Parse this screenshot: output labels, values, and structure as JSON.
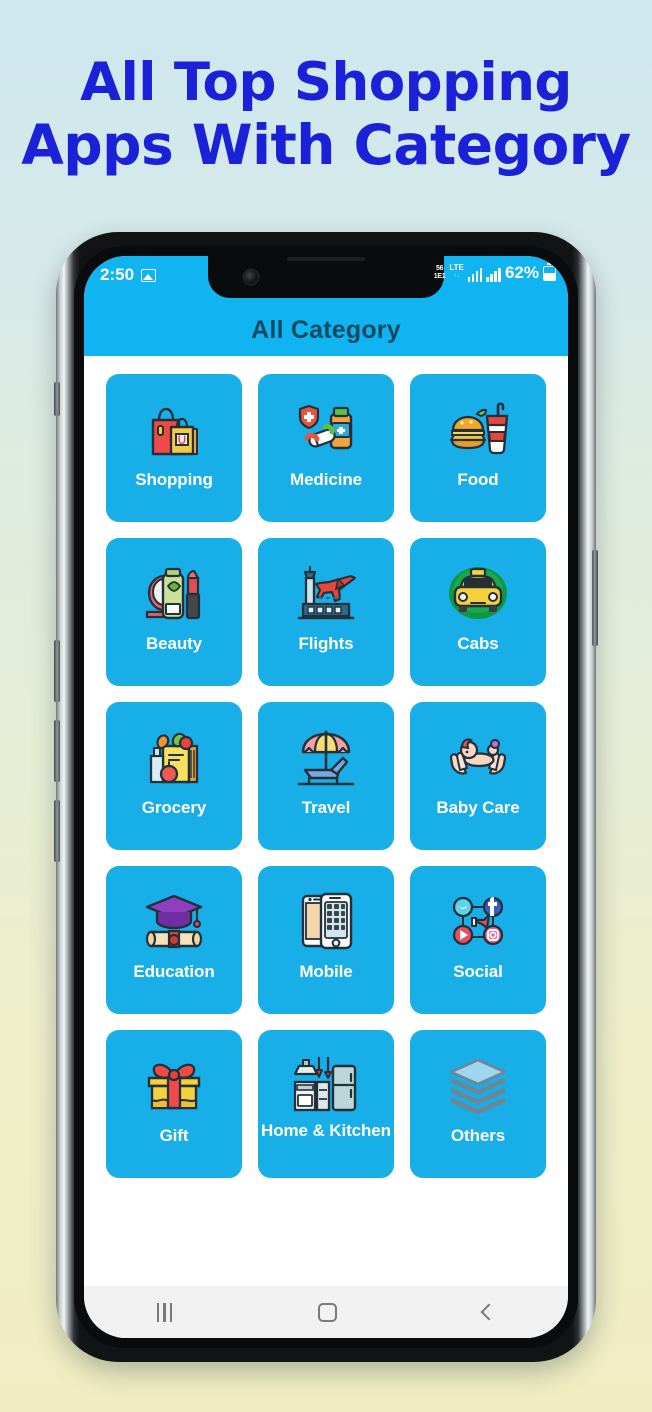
{
  "promo": {
    "line1": "All Top Shopping",
    "line2": "Apps With Category",
    "text_color": "#1a21d6"
  },
  "background": {
    "gradient_top": "#cde8ef",
    "gradient_bottom": "#f1edc3"
  },
  "phone": {
    "status_bar": {
      "time": "2:50",
      "left_icon": "image-icon",
      "network_label_top": "56",
      "network_label_bottom": "1E1",
      "lte_label": "LTE",
      "lte_dots": "↑↓",
      "signal_icon_1": "signal-bars-icon",
      "signal_icon_2": "signal-bars-icon",
      "battery_percent": "62%",
      "battery_icon": "battery-icon",
      "background_color": "#10b4f0"
    },
    "app_bar": {
      "title": "All Category",
      "background_color": "#10b4f0",
      "title_color": "#0e4a63"
    },
    "nav_bar": {
      "recents": "recents-icon",
      "home": "home-icon",
      "back": "back-icon"
    }
  },
  "categories": [
    {
      "label": "Shopping",
      "icon": "shopping-bags-icon"
    },
    {
      "label": "Medicine",
      "icon": "medicine-pills-icon"
    },
    {
      "label": "Food",
      "icon": "burger-drink-icon"
    },
    {
      "label": "Beauty",
      "icon": "cosmetics-icon"
    },
    {
      "label": "Flights",
      "icon": "airplane-airport-icon"
    },
    {
      "label": "Cabs",
      "icon": "taxi-icon"
    },
    {
      "label": "Grocery",
      "icon": "grocery-bag-icon"
    },
    {
      "label": "Travel",
      "icon": "beach-umbrella-icon"
    },
    {
      "label": "Baby Care",
      "icon": "baby-in-hands-icon"
    },
    {
      "label": "Education",
      "icon": "graduation-cap-diploma-icon"
    },
    {
      "label": "Mobile",
      "icon": "smartphone-icon"
    },
    {
      "label": "Social",
      "icon": "social-network-icon"
    },
    {
      "label": "Gift",
      "icon": "gift-box-icon"
    },
    {
      "label": "Home & Kitchen",
      "icon": "kitchen-appliances-icon"
    },
    {
      "label": "Others",
      "icon": "layers-stack-icon"
    }
  ],
  "tile_color": "#18aee8",
  "tile_label_color": "#ffffff"
}
